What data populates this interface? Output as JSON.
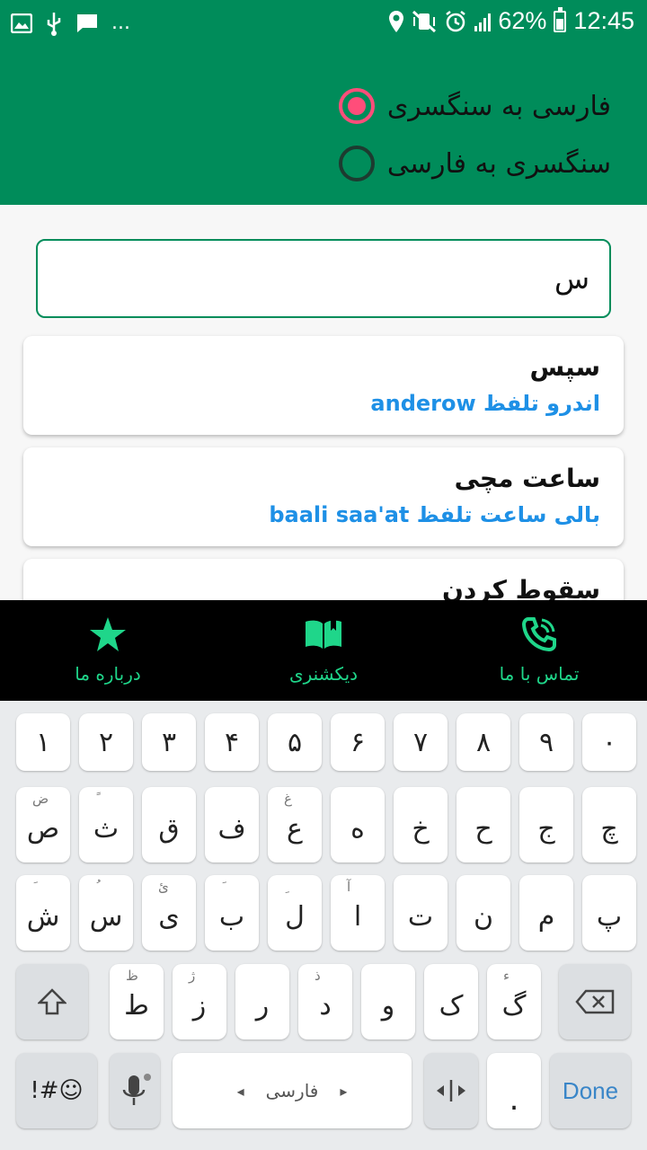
{
  "status_bar": {
    "battery": "62%",
    "time": "12:45",
    "left_icons": [
      "image-icon",
      "usb-icon",
      "message-icon",
      "more-dots"
    ],
    "more": "..."
  },
  "direction": {
    "options": [
      {
        "label": "فارسی به سنگسری",
        "selected": true
      },
      {
        "label": "سنگسری به فارسی",
        "selected": false
      }
    ]
  },
  "search": {
    "value": "س"
  },
  "results": [
    {
      "word": "سپس",
      "pron_fa": "اندرو",
      "pron_word": "تلفظ",
      "pron_latin": "anderow"
    },
    {
      "word": "ساعت مچی",
      "pron_fa": "بالی ساعت",
      "pron_word": "تلفظ",
      "pron_latin": "baali saa'at"
    },
    {
      "word": "سقوط کردن",
      "pron_fa": "",
      "pron_word": "",
      "pron_latin": ""
    }
  ],
  "bottom_nav": {
    "items": [
      {
        "label": "درباره ما",
        "icon": "star-icon"
      },
      {
        "label": "دیکشنری",
        "icon": "book-icon"
      },
      {
        "label": "تماس با ما",
        "icon": "phone-icon"
      }
    ],
    "color": "#1fd68a"
  },
  "keyboard": {
    "row1": [
      "۱",
      "۲",
      "۳",
      "۴",
      "۵",
      "۶",
      "۷",
      "۸",
      "۹",
      "۰"
    ],
    "row2": [
      {
        "ch": "ص",
        "hint": "ض"
      },
      {
        "ch": "ث",
        "hint": "ً"
      },
      {
        "ch": "ق",
        "hint": ""
      },
      {
        "ch": "ف",
        "hint": ""
      },
      {
        "ch": "ع",
        "hint": "غ"
      },
      {
        "ch": "ه",
        "hint": ""
      },
      {
        "ch": "خ",
        "hint": ""
      },
      {
        "ch": "ح",
        "hint": ""
      },
      {
        "ch": "ج",
        "hint": ""
      },
      {
        "ch": "چ",
        "hint": ""
      }
    ],
    "row3": [
      {
        "ch": "ش",
        "hint": "َ"
      },
      {
        "ch": "س",
        "hint": "ُ"
      },
      {
        "ch": "ی",
        "hint": "ئ"
      },
      {
        "ch": "ب",
        "hint": "َ"
      },
      {
        "ch": "ل",
        "hint": "ِ"
      },
      {
        "ch": "ا",
        "hint": "آ"
      },
      {
        "ch": "ت",
        "hint": ""
      },
      {
        "ch": "ن",
        "hint": ""
      },
      {
        "ch": "م",
        "hint": ""
      },
      {
        "ch": "پ",
        "hint": ""
      }
    ],
    "row4": [
      {
        "ch": "ط",
        "hint": "ظ"
      },
      {
        "ch": "ز",
        "hint": "ژ"
      },
      {
        "ch": "ر",
        "hint": ""
      },
      {
        "ch": "د",
        "hint": "ذ"
      },
      {
        "ch": "و",
        "hint": ""
      },
      {
        "ch": "ک",
        "hint": ""
      },
      {
        "ch": "گ",
        "hint": "ء"
      }
    ],
    "symbols_label": "!#☺",
    "space_label": "فارسی",
    "period_label": ".",
    "done_label": "Done"
  },
  "colors": {
    "primary": "#008c5a",
    "radio_selected": "#ff4d7a",
    "pronunciation": "#1e90e6",
    "nav_accent": "#1fd68a",
    "done_text": "#3a86c8"
  }
}
